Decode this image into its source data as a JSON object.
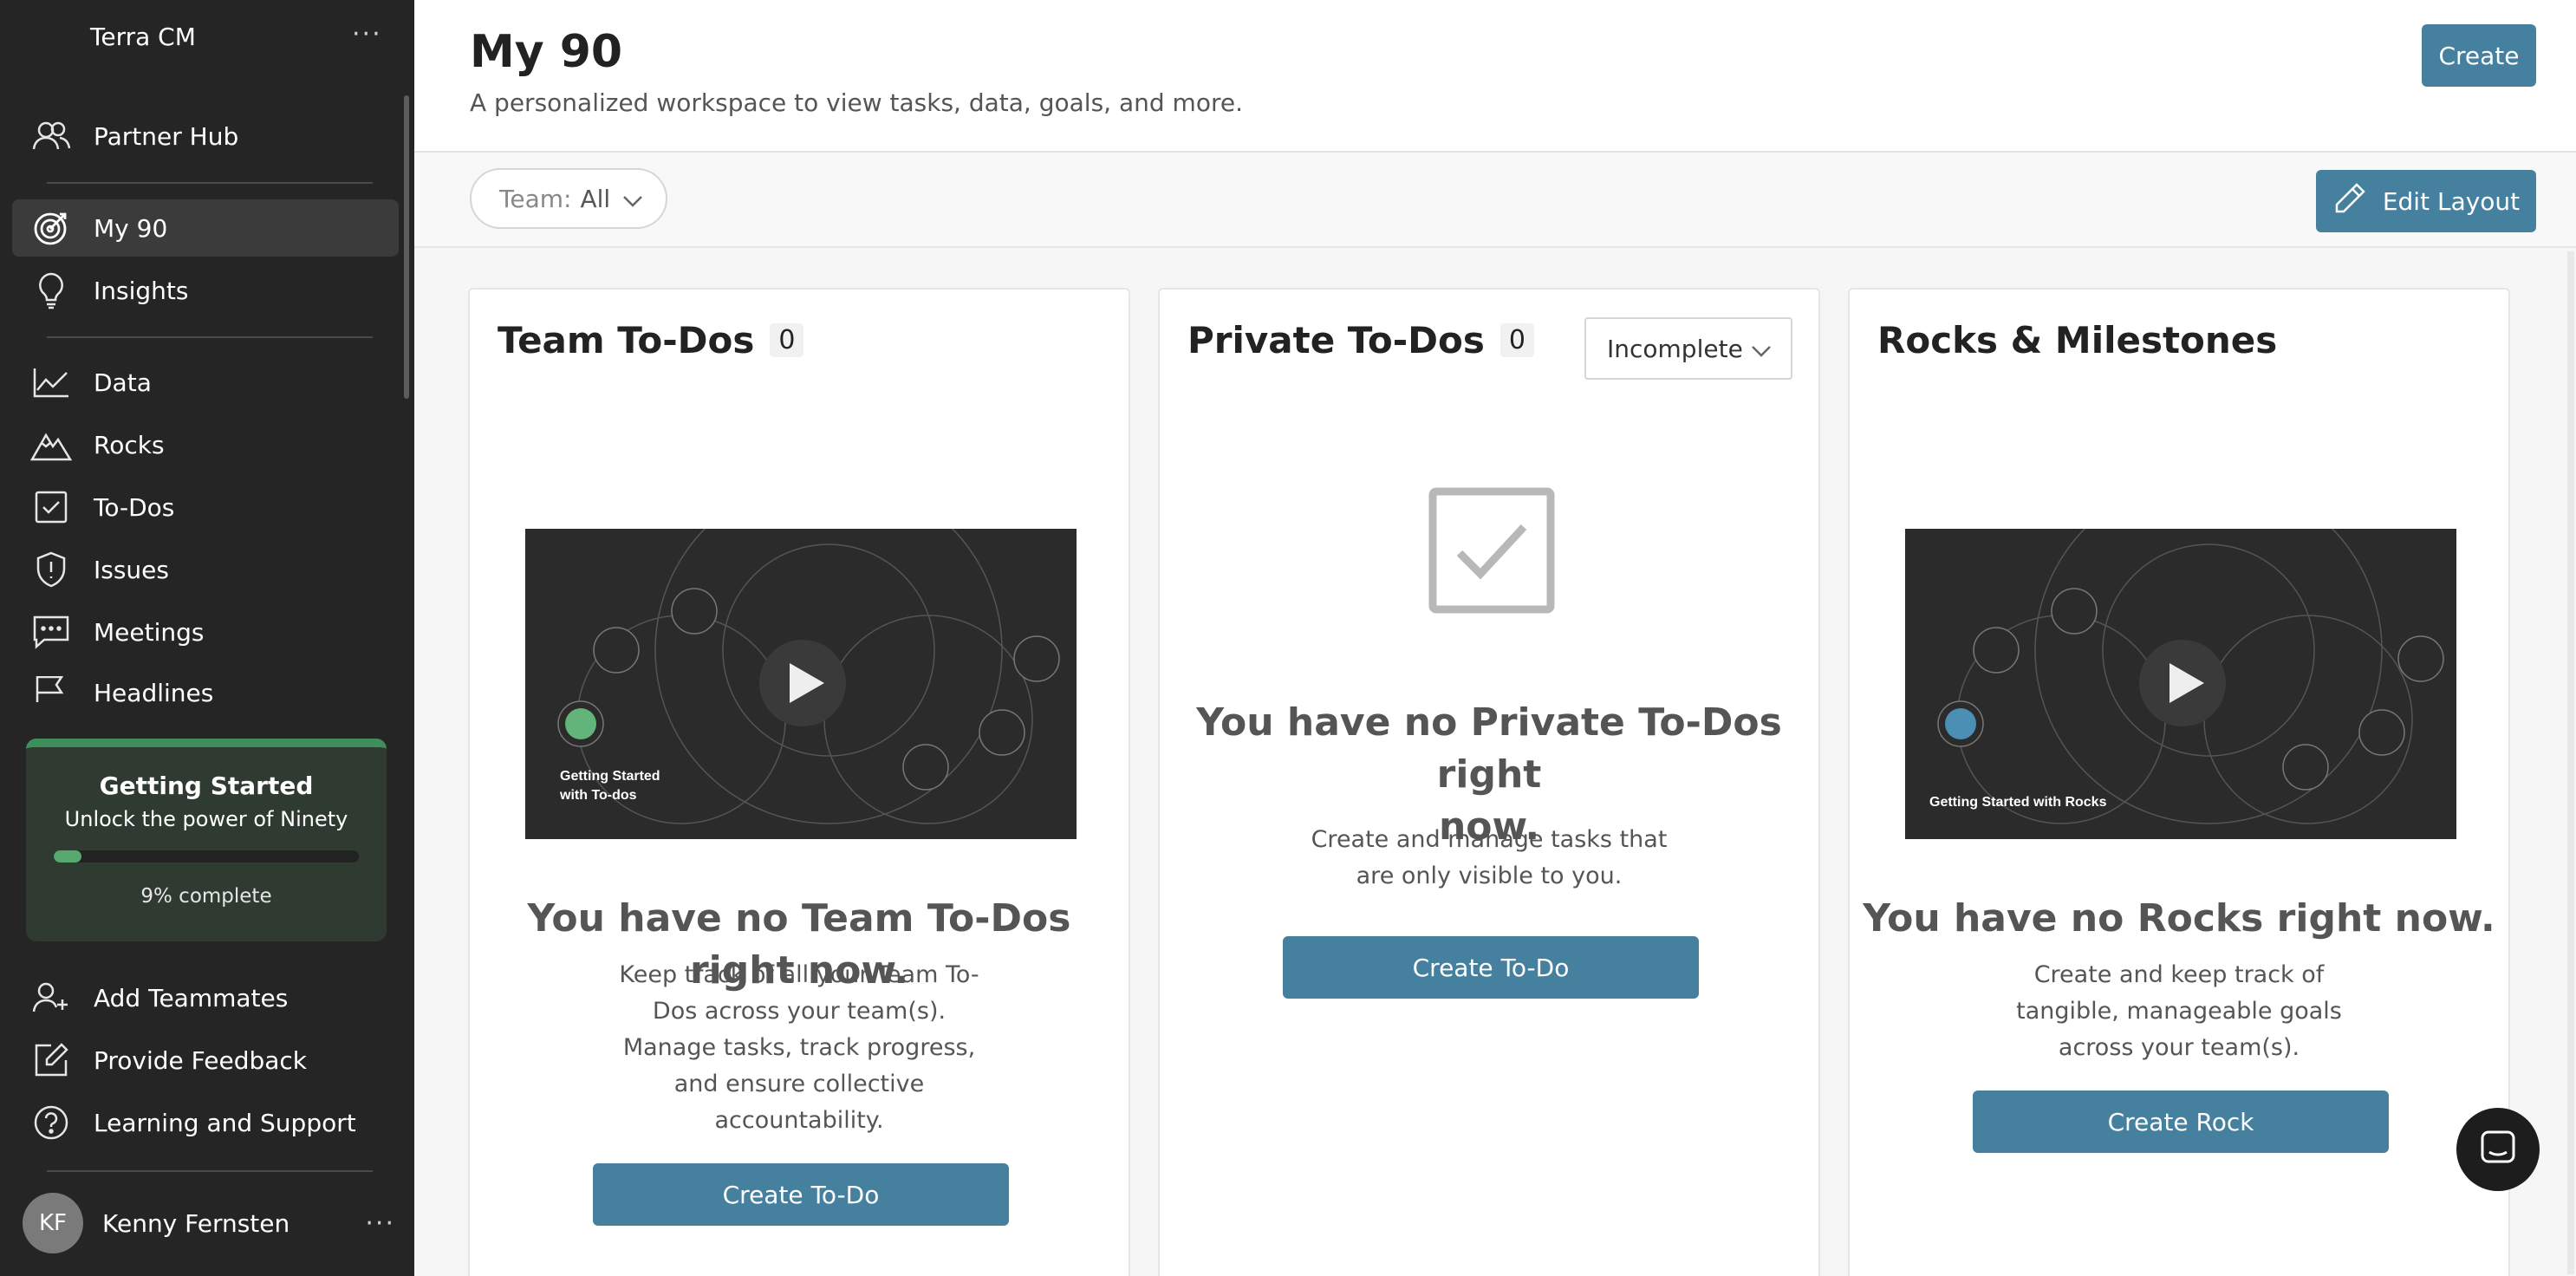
{
  "sidebar": {
    "workspace_name": "Terra CM",
    "more_label": "···",
    "nav": [
      {
        "label": "Partner Hub",
        "icon": "partner-hub-icon"
      },
      {
        "label": "My 90",
        "icon": "target-icon",
        "active": true
      },
      {
        "label": "Insights",
        "icon": "lightbulb-icon"
      },
      {
        "label": "Data",
        "icon": "line-chart-icon"
      },
      {
        "label": "Rocks",
        "icon": "mountain-icon"
      },
      {
        "label": "To-Dos",
        "icon": "checkbox-icon"
      },
      {
        "label": "Issues",
        "icon": "shield-alert-icon"
      },
      {
        "label": "Meetings",
        "icon": "chat-icon"
      },
      {
        "label": "Headlines",
        "icon": "flag-icon"
      }
    ],
    "getting_started": {
      "title": "Getting Started",
      "subtitle": "Unlock the power of Ninety",
      "progress": 0.09,
      "progress_text": "9% complete",
      "accent": "#3f8f5c"
    },
    "bottom_nav": [
      {
        "label": "Add Teammates",
        "icon": "add-user-icon"
      },
      {
        "label": "Provide Feedback",
        "icon": "edit-square-icon"
      },
      {
        "label": "Learning and Support",
        "icon": "help-circle-icon"
      }
    ],
    "user": {
      "initials": "KF",
      "name": "Kenny Fernsten",
      "more_label": "···"
    }
  },
  "header": {
    "title": "My 90",
    "subtitle": "A personalized workspace to view tasks, data, goals, and more.",
    "create_label": "Create"
  },
  "toolbar": {
    "team_filter_label": "Team:",
    "team_filter_value": "All",
    "edit_layout_label": "Edit Layout"
  },
  "cards": {
    "team_todos": {
      "title": "Team To-Dos",
      "count": "0",
      "video_caption": "Getting Started with To-dos",
      "empty_title": "You have no Team To-Dos right now.",
      "empty_lines": [
        "Keep track of all your Team To-",
        "Dos across your team(s).",
        "Manage tasks, track progress,",
        "and ensure collective",
        "accountability."
      ],
      "button": "Create To-Do"
    },
    "private_todos": {
      "title": "Private To-Dos",
      "count": "0",
      "filter_value": "Incomplete",
      "empty_title_lines": [
        "You have no Private To-Dos right",
        "now."
      ],
      "empty_lines": [
        "Create and manage tasks that",
        "are only visible to you."
      ],
      "button": "Create To-Do"
    },
    "rocks": {
      "title": "Rocks & Milestones",
      "video_caption": "Getting Started with Rocks",
      "empty_title": "You have no Rocks right now.",
      "empty_lines": [
        "Create and keep track of",
        "tangible, manageable goals",
        "across your team(s)."
      ],
      "button": "Create Rock"
    }
  },
  "colors": {
    "primary": "#45809f",
    "sidebar_bg": "#252525"
  }
}
